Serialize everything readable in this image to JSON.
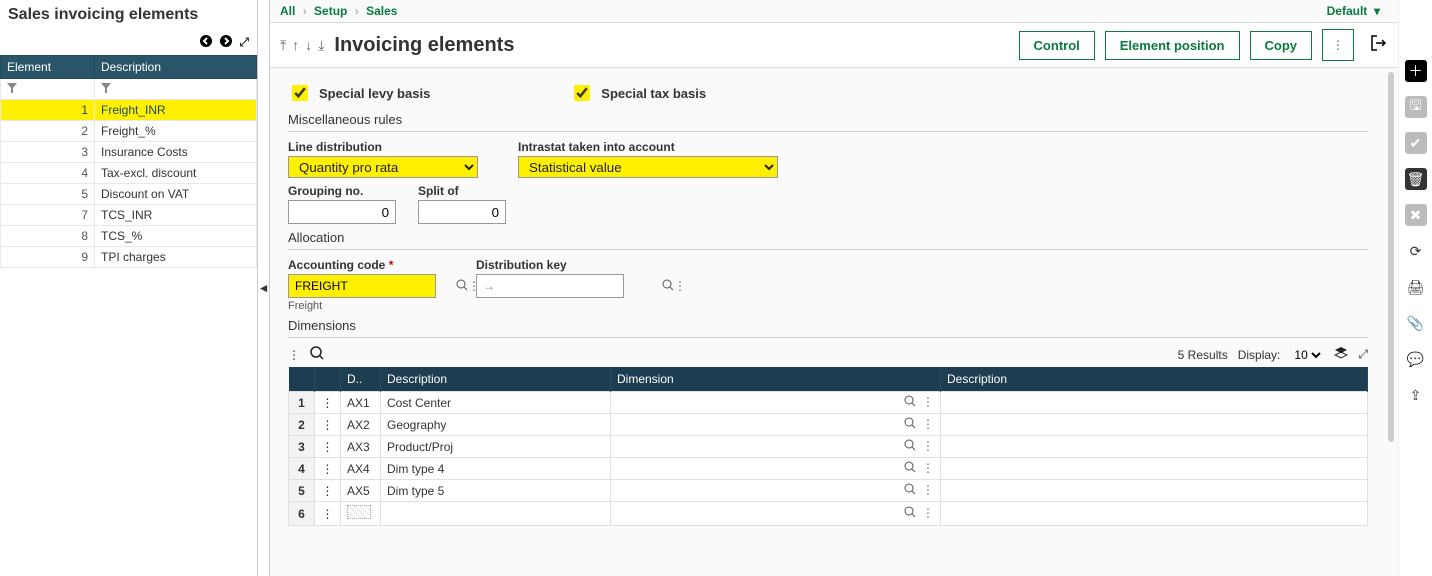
{
  "breadcrumb": {
    "all": "All",
    "setup": "Setup",
    "sales": "Sales"
  },
  "header": {
    "default_label": "Default",
    "page_title": "Invoicing elements"
  },
  "actions": {
    "control": "Control",
    "element_position": "Element position",
    "copy": "Copy"
  },
  "left": {
    "title": "Sales invoicing elements",
    "col_element": "Element",
    "col_description": "Description",
    "rows": [
      {
        "idx": "1",
        "desc": "Freight_INR"
      },
      {
        "idx": "2",
        "desc": "Freight_%"
      },
      {
        "idx": "3",
        "desc": "Insurance Costs"
      },
      {
        "idx": "4",
        "desc": "Tax-excl. discount"
      },
      {
        "idx": "5",
        "desc": "Discount on VAT"
      },
      {
        "idx": "7",
        "desc": "TCS_INR"
      },
      {
        "idx": "8",
        "desc": "TCS_%"
      },
      {
        "idx": "9",
        "desc": "TPI charges"
      }
    ]
  },
  "form": {
    "cb_special_levy": "Special levy basis",
    "cb_special_tax": "Special tax basis",
    "misc_title": "Miscellaneous rules",
    "line_dist_label": "Line distribution",
    "line_dist_value": "Quantity pro rata",
    "intrastat_label": "Intrastat taken into account",
    "intrastat_value": "Statistical value",
    "grouping_label": "Grouping no.",
    "grouping_value": "0",
    "split_label": "Split of",
    "split_value": "0",
    "allocation_title": "Allocation",
    "acct_label": "Accounting code",
    "acct_value": "FREIGHT",
    "acct_subtext": "Freight",
    "dist_key_label": "Distribution key",
    "dim_title": "Dimensions"
  },
  "dim": {
    "results_label": "5 Results",
    "display_label": "Display:",
    "display_value": "10",
    "col_code": "D..",
    "col_desc": "Description",
    "col_dimension": "Dimension",
    "col_desc2": "Description",
    "rows": [
      {
        "idx": "1",
        "code": "AX1",
        "desc": "Cost Center"
      },
      {
        "idx": "2",
        "code": "AX2",
        "desc": "Geography"
      },
      {
        "idx": "3",
        "code": "AX3",
        "desc": "Product/Proj"
      },
      {
        "idx": "4",
        "code": "AX4",
        "desc": "Dim type 4"
      },
      {
        "idx": "5",
        "code": "AX5",
        "desc": "Dim type 5"
      }
    ]
  }
}
